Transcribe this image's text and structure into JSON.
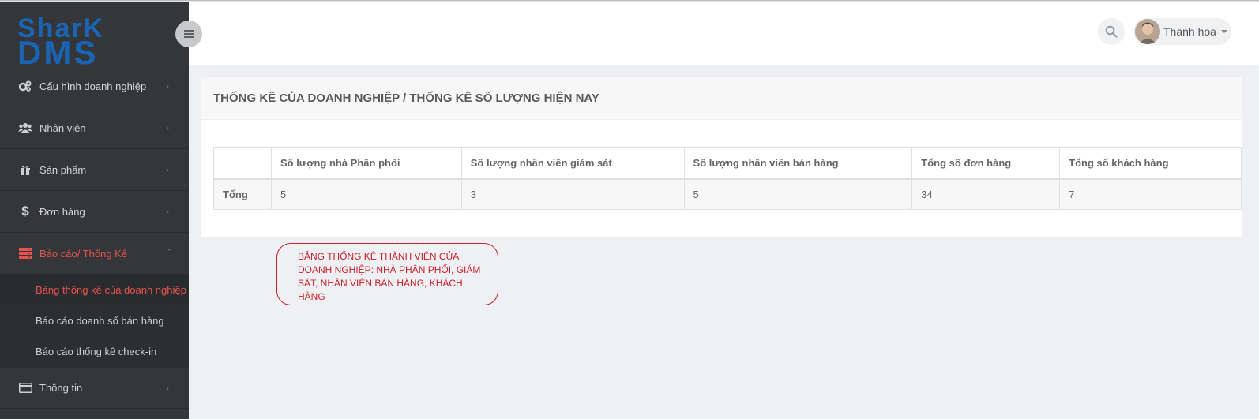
{
  "brand": {
    "logo_text_top": "SharK",
    "logo_text_bottom": "DMS"
  },
  "sidebar": {
    "items": [
      {
        "label": "Cấu hình doanh nghiệp",
        "icon": "gears-icon"
      },
      {
        "label": "Nhân viên",
        "icon": "users-icon"
      },
      {
        "label": "Sản phẩm",
        "icon": "gift-icon"
      },
      {
        "label": "Đơn hàng",
        "icon": "dollar-icon"
      },
      {
        "label": "Báo cáo/ Thống Kê",
        "icon": "server-icon",
        "active": true
      },
      {
        "label": "Thông tin",
        "icon": "credit-card-icon"
      }
    ],
    "subitems": [
      {
        "label": "Bảng thống kê của doanh nghiệp",
        "current": true
      },
      {
        "label": "Báo cáo doanh số bán hàng"
      },
      {
        "label": "Báo cáo thống kê check-in"
      }
    ]
  },
  "header": {
    "user_name": "Thanh hoa"
  },
  "panel": {
    "title": "THỐNG KÊ CỦA DOANH NGHIỆP / THỐNG KÊ SỐ LƯỢNG HIỆN NAY",
    "table": {
      "headers": [
        "",
        "Số lượng nhà Phân phối",
        "Số lượng nhân viên giám sát",
        "Số lượng nhân viên bán hàng",
        "Tổng số đơn hàng",
        "Tổng số khách hàng"
      ],
      "rows": [
        [
          "Tổng",
          "5",
          "3",
          "5",
          "34",
          "7"
        ]
      ]
    }
  },
  "annotation": {
    "text": "BẢNG THỐNG KÊ THÀNH VIÊN CỦA DOANH NGHIỆP: NHÀ PHÂN PHỐI, GIÁM SÁT, NHÂN VIÊN BÁN HÀNG, KHÁCH HÀNG"
  },
  "colors": {
    "sidebar_bg": "#35363a",
    "active": "#e8534d",
    "logo_blue": "#1a64b4",
    "annotation": "#c8202a"
  }
}
